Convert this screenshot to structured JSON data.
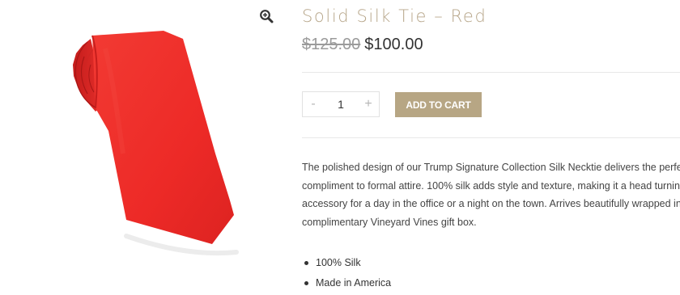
{
  "product": {
    "title": "Solid Silk Tie – Red",
    "regular_price": "$125.00",
    "sale_price": "$100.00",
    "image_alt": "Solid Silk Tie – Red",
    "tie_color": "#ee2b29"
  },
  "cart": {
    "minus_label": "-",
    "plus_label": "+",
    "quantity": "1",
    "add_to_cart_label": "ADD TO CART",
    "button_color": "#b7a684"
  },
  "description_lines": [
    "The polished design of our Trump Signature Collection Silk Necktie delivers the perfect",
    "compliment to formal attire. 100% silk  adds style and texture, making it a head turning",
    "accessory for a day in the office or a night on the town. Arrives beautifully wrapped in a",
    "complimentary Vineyard Vines gift box."
  ],
  "features": [
    "100% Silk",
    "Made in America"
  ],
  "icons": {
    "zoom": "zoom-in-icon"
  },
  "colors": {
    "title": "#b7a68a",
    "accent": "#b7a684"
  }
}
